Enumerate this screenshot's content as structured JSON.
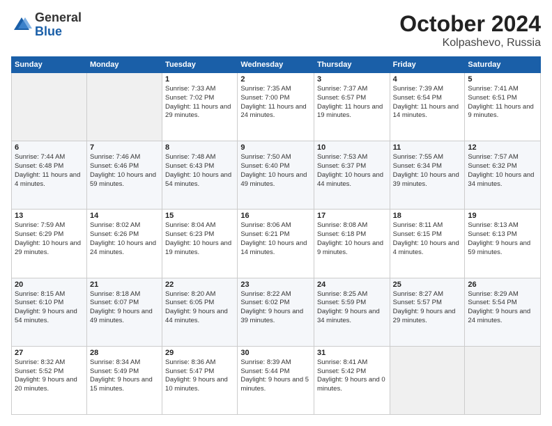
{
  "logo": {
    "general": "General",
    "blue": "Blue"
  },
  "title": "October 2024",
  "subtitle": "Kolpashevo, Russia",
  "days_of_week": [
    "Sunday",
    "Monday",
    "Tuesday",
    "Wednesday",
    "Thursday",
    "Friday",
    "Saturday"
  ],
  "weeks": [
    [
      {
        "day": "",
        "info": ""
      },
      {
        "day": "",
        "info": ""
      },
      {
        "day": "1",
        "info": "Sunrise: 7:33 AM\nSunset: 7:02 PM\nDaylight: 11 hours and 29 minutes."
      },
      {
        "day": "2",
        "info": "Sunrise: 7:35 AM\nSunset: 7:00 PM\nDaylight: 11 hours and 24 minutes."
      },
      {
        "day": "3",
        "info": "Sunrise: 7:37 AM\nSunset: 6:57 PM\nDaylight: 11 hours and 19 minutes."
      },
      {
        "day": "4",
        "info": "Sunrise: 7:39 AM\nSunset: 6:54 PM\nDaylight: 11 hours and 14 minutes."
      },
      {
        "day": "5",
        "info": "Sunrise: 7:41 AM\nSunset: 6:51 PM\nDaylight: 11 hours and 9 minutes."
      }
    ],
    [
      {
        "day": "6",
        "info": "Sunrise: 7:44 AM\nSunset: 6:48 PM\nDaylight: 11 hours and 4 minutes."
      },
      {
        "day": "7",
        "info": "Sunrise: 7:46 AM\nSunset: 6:46 PM\nDaylight: 10 hours and 59 minutes."
      },
      {
        "day": "8",
        "info": "Sunrise: 7:48 AM\nSunset: 6:43 PM\nDaylight: 10 hours and 54 minutes."
      },
      {
        "day": "9",
        "info": "Sunrise: 7:50 AM\nSunset: 6:40 PM\nDaylight: 10 hours and 49 minutes."
      },
      {
        "day": "10",
        "info": "Sunrise: 7:53 AM\nSunset: 6:37 PM\nDaylight: 10 hours and 44 minutes."
      },
      {
        "day": "11",
        "info": "Sunrise: 7:55 AM\nSunset: 6:34 PM\nDaylight: 10 hours and 39 minutes."
      },
      {
        "day": "12",
        "info": "Sunrise: 7:57 AM\nSunset: 6:32 PM\nDaylight: 10 hours and 34 minutes."
      }
    ],
    [
      {
        "day": "13",
        "info": "Sunrise: 7:59 AM\nSunset: 6:29 PM\nDaylight: 10 hours and 29 minutes."
      },
      {
        "day": "14",
        "info": "Sunrise: 8:02 AM\nSunset: 6:26 PM\nDaylight: 10 hours and 24 minutes."
      },
      {
        "day": "15",
        "info": "Sunrise: 8:04 AM\nSunset: 6:23 PM\nDaylight: 10 hours and 19 minutes."
      },
      {
        "day": "16",
        "info": "Sunrise: 8:06 AM\nSunset: 6:21 PM\nDaylight: 10 hours and 14 minutes."
      },
      {
        "day": "17",
        "info": "Sunrise: 8:08 AM\nSunset: 6:18 PM\nDaylight: 10 hours and 9 minutes."
      },
      {
        "day": "18",
        "info": "Sunrise: 8:11 AM\nSunset: 6:15 PM\nDaylight: 10 hours and 4 minutes."
      },
      {
        "day": "19",
        "info": "Sunrise: 8:13 AM\nSunset: 6:13 PM\nDaylight: 9 hours and 59 minutes."
      }
    ],
    [
      {
        "day": "20",
        "info": "Sunrise: 8:15 AM\nSunset: 6:10 PM\nDaylight: 9 hours and 54 minutes."
      },
      {
        "day": "21",
        "info": "Sunrise: 8:18 AM\nSunset: 6:07 PM\nDaylight: 9 hours and 49 minutes."
      },
      {
        "day": "22",
        "info": "Sunrise: 8:20 AM\nSunset: 6:05 PM\nDaylight: 9 hours and 44 minutes."
      },
      {
        "day": "23",
        "info": "Sunrise: 8:22 AM\nSunset: 6:02 PM\nDaylight: 9 hours and 39 minutes."
      },
      {
        "day": "24",
        "info": "Sunrise: 8:25 AM\nSunset: 5:59 PM\nDaylight: 9 hours and 34 minutes."
      },
      {
        "day": "25",
        "info": "Sunrise: 8:27 AM\nSunset: 5:57 PM\nDaylight: 9 hours and 29 minutes."
      },
      {
        "day": "26",
        "info": "Sunrise: 8:29 AM\nSunset: 5:54 PM\nDaylight: 9 hours and 24 minutes."
      }
    ],
    [
      {
        "day": "27",
        "info": "Sunrise: 8:32 AM\nSunset: 5:52 PM\nDaylight: 9 hours and 20 minutes."
      },
      {
        "day": "28",
        "info": "Sunrise: 8:34 AM\nSunset: 5:49 PM\nDaylight: 9 hours and 15 minutes."
      },
      {
        "day": "29",
        "info": "Sunrise: 8:36 AM\nSunset: 5:47 PM\nDaylight: 9 hours and 10 minutes."
      },
      {
        "day": "30",
        "info": "Sunrise: 8:39 AM\nSunset: 5:44 PM\nDaylight: 9 hours and 5 minutes."
      },
      {
        "day": "31",
        "info": "Sunrise: 8:41 AM\nSunset: 5:42 PM\nDaylight: 9 hours and 0 minutes."
      },
      {
        "day": "",
        "info": ""
      },
      {
        "day": "",
        "info": ""
      }
    ]
  ]
}
